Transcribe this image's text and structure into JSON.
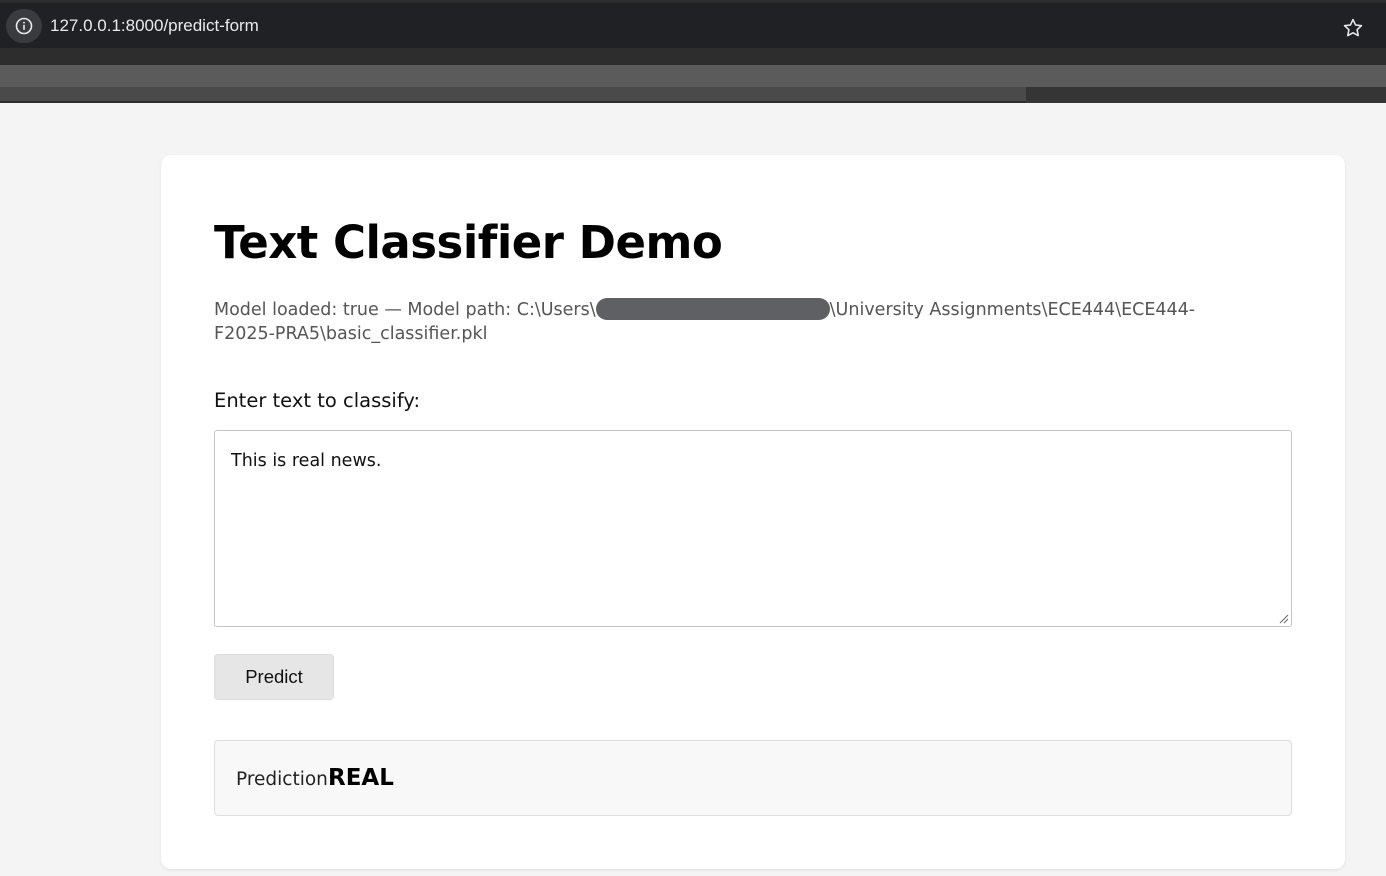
{
  "browser": {
    "url": "127.0.0.1:8000/predict-form",
    "info_icon": "info-icon",
    "bookmark_icon": "star-icon"
  },
  "page": {
    "title": "Text Classifier Demo",
    "model_info_prefix": "Model loaded: true — Model path: C:\\Users\\",
    "model_info_suffix": "\\University Assignments\\ECE444\\ECE444-F2025-PRA5\\basic_classifier.pkl",
    "input_label": "Enter text to classify:",
    "input_value": "This is real news.",
    "predict_label": "Predict",
    "prediction_label": "Prediction:",
    "prediction_value": "REAL"
  },
  "colors": {
    "page_background": "#f4f4f4",
    "card_background": "#ffffff",
    "browser_chrome": "#202124"
  }
}
